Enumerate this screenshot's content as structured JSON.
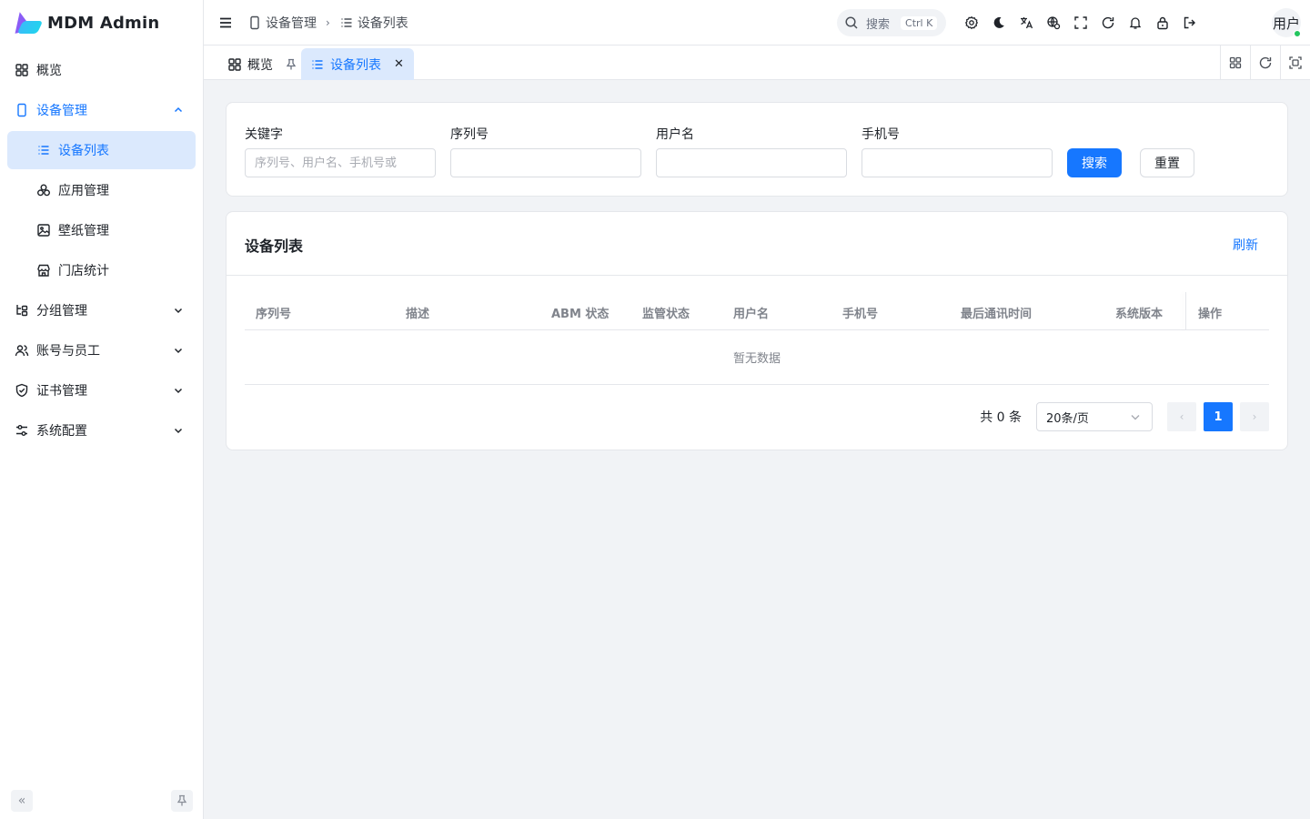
{
  "app": {
    "title": "MDM Admin"
  },
  "sidebar": {
    "items": [
      {
        "label": "概览",
        "icon": "grid-icon"
      },
      {
        "label": "设备管理",
        "icon": "device-icon"
      },
      {
        "label": "设备列表",
        "icon": "list-icon"
      },
      {
        "label": "应用管理",
        "icon": "apps-icon"
      },
      {
        "label": "壁纸管理",
        "icon": "image-icon"
      },
      {
        "label": "门店统计",
        "icon": "store-icon"
      },
      {
        "label": "分组管理",
        "icon": "group-icon"
      },
      {
        "label": "账号与员工",
        "icon": "users-icon"
      },
      {
        "label": "证书管理",
        "icon": "shield-icon"
      },
      {
        "label": "系统配置",
        "icon": "settings-sliders-icon"
      }
    ]
  },
  "header": {
    "breadcrumb": [
      "设备管理",
      "设备列表"
    ],
    "search_label": "搜索",
    "search_shortcut": "Ctrl K",
    "user_label": "用户"
  },
  "tabs": [
    {
      "label": "概览"
    },
    {
      "label": "设备列表"
    }
  ],
  "filter": {
    "fields": [
      {
        "label": "关键字",
        "placeholder": "序列号、用户名、手机号或",
        "value": ""
      },
      {
        "label": "序列号",
        "placeholder": "",
        "value": ""
      },
      {
        "label": "用户名",
        "placeholder": "",
        "value": ""
      },
      {
        "label": "手机号",
        "placeholder": "",
        "value": ""
      }
    ],
    "search_button": "搜索",
    "reset_button": "重置"
  },
  "list": {
    "title": "设备列表",
    "refresh_label": "刷新",
    "columns": [
      "序列号",
      "描述",
      "ABM 状态",
      "监管状态",
      "用户名",
      "手机号",
      "最后通讯时间",
      "系统版本",
      "操作"
    ],
    "rows": [],
    "empty_text": "暂无数据"
  },
  "pagination": {
    "total_text": "共 0 条",
    "page_size": "20条/页",
    "current_page": "1"
  },
  "colors": {
    "primary": "#1677ff",
    "active_bg": "#dbe9fd",
    "online": "#22c55e"
  }
}
